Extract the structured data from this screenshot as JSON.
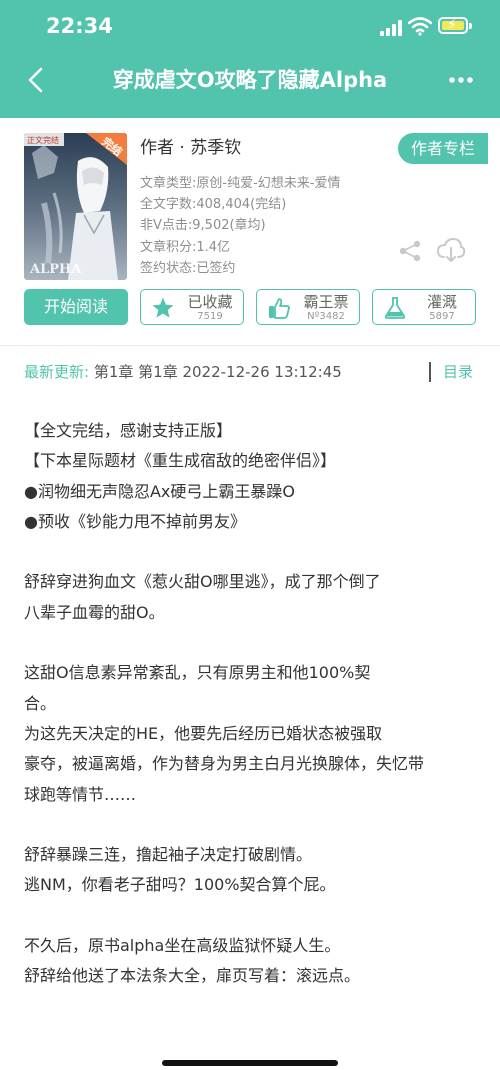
{
  "status_bar": {
    "time": "22:34"
  },
  "nav": {
    "title": "穿成虐文O攻略了隐藏Alpha"
  },
  "cover": {
    "badge": "完结",
    "corner_label": "正文完结",
    "art_text": "ALPHA"
  },
  "book": {
    "author": "作者 · 苏季钦",
    "meta": [
      "文章类型:原创-纯爱-幻想未来-爱情",
      "全文字数:408,404(完结)",
      "非V点击:9,502(章均)",
      "文章积分:1.4亿",
      "签约状态:已签约"
    ]
  },
  "author_column_label": "作者专栏",
  "actions": {
    "read_label": "开始阅读",
    "favorite": {
      "label": "已收藏",
      "count": "7519"
    },
    "vote": {
      "label": "霸王票",
      "count": "Nº3482"
    },
    "water": {
      "label": "灌溉",
      "count": "5897"
    }
  },
  "latest": {
    "label": "最新更新:",
    "value": "第1章 第1章 2022-12-26 13:12:45",
    "toc_label": "目录"
  },
  "content": [
    "【全文完结，感谢支持正版】",
    "【下本星际题材《重生成宿敌的绝密伴侣》】",
    "●润物细无声隐忍Ax硬弓上霸王暴躁O",
    "●预收《钞能力甩不掉前男友》",
    "",
    "      舒辞穿进狗血文《惹火甜O哪里逃》，成了那个倒了",
    "八辈子血霉的甜O。",
    "",
    "      这甜O信息素异常紊乱，只有原男主和他100%契",
    "合。",
    "      为这先天决定的HE，他要先后经历已婚状态被强取",
    "豪夺，被逼离婚，作为替身为男主白月光换腺体，失忆带",
    "球跑等情节……",
    "",
    "      舒辞暴躁三连，撸起袖子决定打破剧情。",
    "      逃NM，你看老子甜吗？100%契合算个屁。",
    "",
    "      不久后，原书alpha坐在高级监狱怀疑人生。",
    "      舒辞给他送了本法条大全，扉页写着：滚远点。"
  ],
  "colors": {
    "accent": "#52c3ac",
    "text": "#333333",
    "meta": "#8e8e8e"
  }
}
